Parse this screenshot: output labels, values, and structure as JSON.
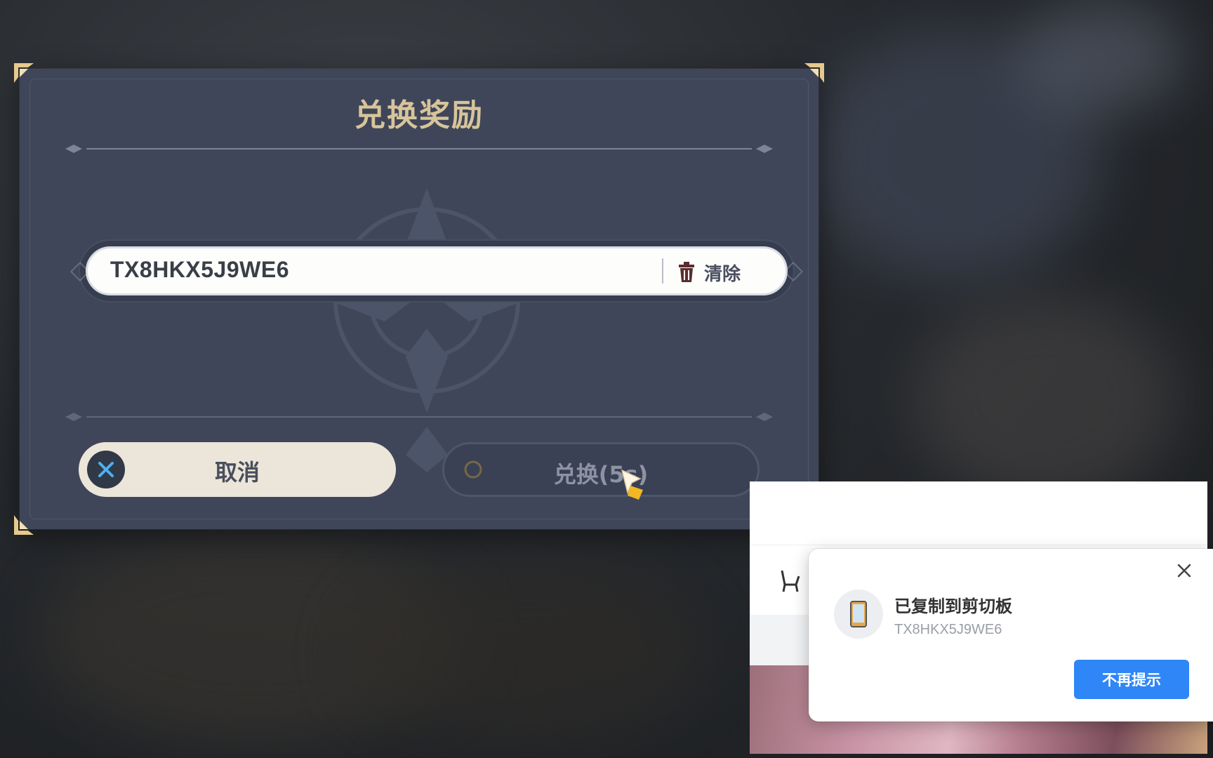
{
  "dialog": {
    "title": "兑换奖励",
    "code_value": "TX8HKX5J9WE6",
    "clear_label": "清除",
    "cancel_label": "取消",
    "confirm_label": "兑换(5s)"
  },
  "toast": {
    "title": "已复制到剪切板",
    "subtitle": "TX8HKX5J9WE6",
    "button_label": "不再提示"
  },
  "colors": {
    "dialog_bg": "#3f4659",
    "title_gold": "#d8c49a",
    "cancel_bg": "#ece5da",
    "toast_button": "#2f86f6"
  },
  "icons": [
    "trash-icon",
    "close-x-icon",
    "circle-icon",
    "phone-icon",
    "close-icon",
    "cursor-icon",
    "corner-ornament-icon"
  ]
}
